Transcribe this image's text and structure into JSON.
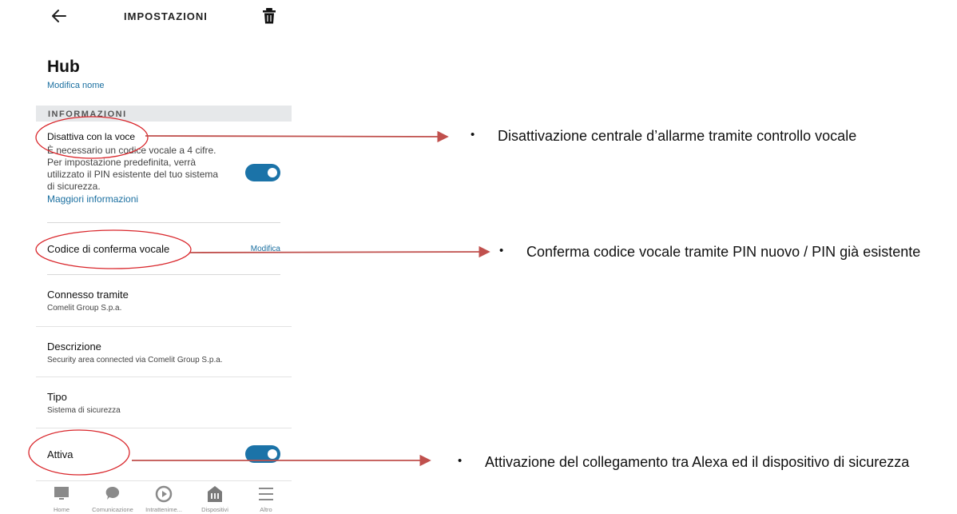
{
  "header": {
    "title": "IMPOSTAZIONI",
    "back_icon": "arrow-left-icon",
    "delete_icon": "trash-icon"
  },
  "device": {
    "name": "Hub",
    "rename_label": "Modifica nome"
  },
  "section": {
    "label": "INFORMAZIONI"
  },
  "voice_disarm": {
    "title": "Disattiva con la voce",
    "desc_line1": "È necessario un codice vocale a 4 cifre.",
    "desc_line2": "Per impostazione predefinita, verrà",
    "desc_line3": "utilizzato il PIN esistente del tuo sistema",
    "desc_line4": "di sicurezza.",
    "more_info": "Maggiori informazioni",
    "enabled": true
  },
  "voice_code": {
    "title": "Codice di conferma vocale",
    "action": "Modifica"
  },
  "connected": {
    "title": "Connesso tramite",
    "value": "Comelit Group S.p.a."
  },
  "description": {
    "title": "Descrizione",
    "value": "Security area connected via Comelit Group S.p.a."
  },
  "type": {
    "title": "Tipo",
    "value": "Sistema di sicurezza"
  },
  "active": {
    "title": "Attiva",
    "enabled": true
  },
  "bottom_nav": [
    {
      "label": "Home",
      "icon": "home-icon"
    },
    {
      "label": "Comunicazione",
      "icon": "chat-bubble-icon"
    },
    {
      "label": "Intrattenime...",
      "icon": "play-icon"
    },
    {
      "label": "Dispositivi",
      "icon": "devices-icon"
    },
    {
      "label": "Altro",
      "icon": "menu-icon"
    }
  ],
  "annotations": [
    {
      "bullet": "•",
      "text": "Disattivazione centrale d’allarme tramite controllo vocale"
    },
    {
      "bullet": "•",
      "text": "Conferma codice vocale tramite PIN nuovo / PIN già esistente"
    },
    {
      "bullet": "•",
      "text": "Attivazione del collegamento tra Alexa ed il dispositivo di sicurezza"
    }
  ],
  "colors": {
    "accent": "#1b73a8",
    "link": "#1a6fa0",
    "annotation_red": "#c0504d",
    "annotation_ellipse": "#d9262b"
  }
}
